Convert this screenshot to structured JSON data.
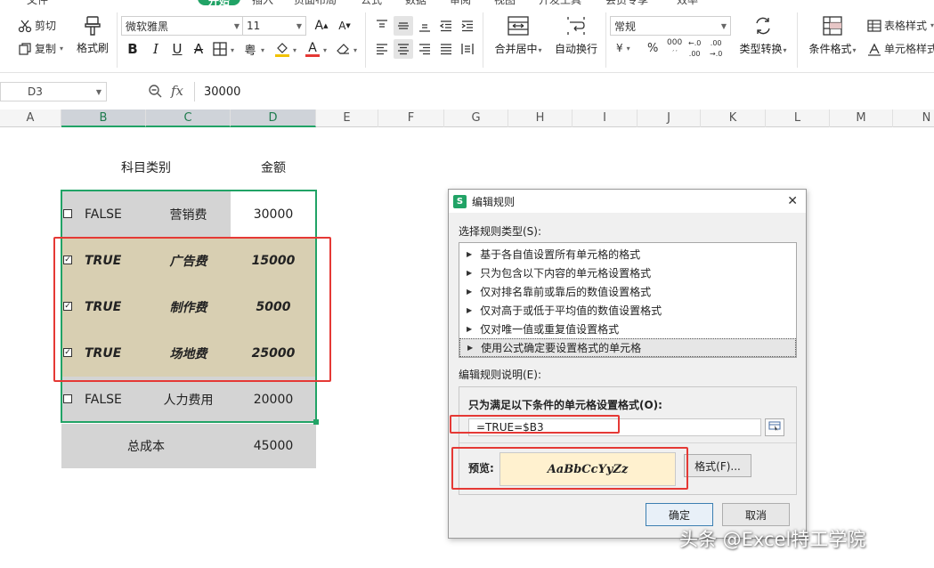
{
  "ribbon": {
    "tabs": [
      "开始",
      "插入",
      "页面布局",
      "公式",
      "数据",
      "审阅",
      "视图",
      "开发工具",
      "会员专享",
      "效率"
    ],
    "active_tab": "开始",
    "clipboard": {
      "cut": "剪切",
      "copy": "复制",
      "format_painter": "格式刷"
    },
    "font": {
      "name": "微软雅黑",
      "size": "11"
    },
    "alignment": {
      "merge_center": "合并居中",
      "wrap_text": "自动换行"
    },
    "number": {
      "format": "常规",
      "currency": "¥",
      "percent": "%",
      "thousands": "000",
      "type_convert": "类型转换"
    },
    "styles": {
      "conditional_format": "条件格式",
      "table_style": "表格样式",
      "cell_style": "单元格样式"
    }
  },
  "formula_bar": {
    "cell_ref": "D3",
    "fx": "fx",
    "value": "30000"
  },
  "columns": [
    "A",
    "B",
    "C",
    "D",
    "E",
    "F",
    "G",
    "H",
    "I",
    "J",
    "K",
    "L",
    "M",
    "N"
  ],
  "sheet": {
    "header_category": "科目类别",
    "header_amount": "金额",
    "rows": [
      {
        "flag": "FALSE",
        "category": "营销费",
        "amount": "30000",
        "checked": false
      },
      {
        "flag": "TRUE",
        "category": "广告费",
        "amount": "15000",
        "checked": true
      },
      {
        "flag": "TRUE",
        "category": "制作费",
        "amount": "5000",
        "checked": true
      },
      {
        "flag": "TRUE",
        "category": "场地费",
        "amount": "25000",
        "checked": true
      },
      {
        "flag": "FALSE",
        "category": "人力费用",
        "amount": "20000",
        "checked": false
      }
    ],
    "total_label": "总成本",
    "total_value": "45000",
    "check_mark": "✓"
  },
  "dialog": {
    "title": "编辑规则",
    "close": "✕",
    "select_type_label": "选择规则类型(S):",
    "rule_types": [
      "基于各自值设置所有单元格的格式",
      "只为包含以下内容的单元格设置格式",
      "仅对排名靠前或靠后的数值设置格式",
      "仅对高于或低于平均值的数值设置格式",
      "仅对唯一值或重复值设置格式",
      "使用公式确定要设置格式的单元格"
    ],
    "selected_index": 5,
    "edit_desc_label": "编辑规则说明(E):",
    "formula_label": "只为满足以下条件的单元格设置格式(O):",
    "formula": "=TRUE=$B3",
    "preview_label": "预览:",
    "preview_text": "AaBbCcYyZz",
    "format_button": "格式(F)...",
    "ok": "确定",
    "cancel": "取消"
  },
  "watermark": "头条 @Excel特工学院",
  "colors": {
    "accent_green": "#21a366",
    "highlight_red": "#e53935",
    "true_row_fill": "#d8cfb2",
    "preview_fill": "#fff1cf"
  }
}
